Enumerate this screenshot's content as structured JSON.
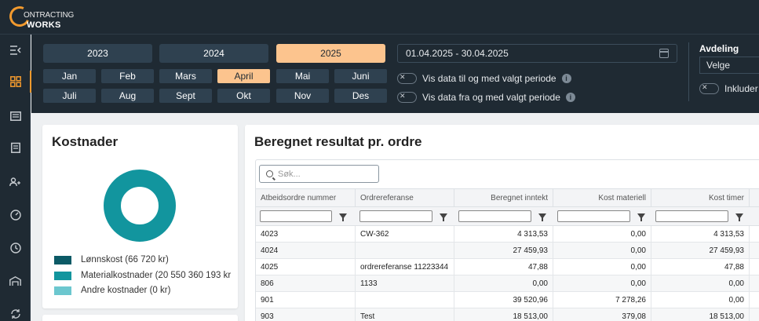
{
  "app": {
    "logo_line1": "ONTRACTING",
    "logo_line2": "WORKS"
  },
  "sidebar": {
    "icons": [
      "menu-collapse-icon",
      "dashboard-icon",
      "document-list-icon",
      "clipboard-icon",
      "users-icon",
      "gauge-icon",
      "clock-icon",
      "warehouse-icon",
      "sync-icon"
    ],
    "active": "dashboard-icon"
  },
  "filters": {
    "years": [
      "2023",
      "2024",
      "2025"
    ],
    "selected_year": "2025",
    "months_row1": [
      "Jan",
      "Feb",
      "Mars",
      "April",
      "Mai",
      "Juni"
    ],
    "months_row2": [
      "Juli",
      "Aug",
      "Sept",
      "Okt",
      "Nov",
      "Des"
    ],
    "selected_month": "April",
    "date_range": "01.04.2025 - 30.04.2025",
    "toggle1_label": "Vis data til og med valgt periode",
    "toggle2_label": "Vis data fra og med valgt periode",
    "avdeling_label": "Avdeling",
    "avdeling_value": "Velge",
    "include_label": "Inkluder"
  },
  "kostnader": {
    "title": "Kostnader",
    "legend": [
      {
        "label": "Lønnskost (66 720 kr)",
        "color": "#0c5a66"
      },
      {
        "label": "Materialkostnader (20 550 360 193 kr",
        "color": "#12959e"
      },
      {
        "label": "Andre kostnader (0 kr)",
        "color": "#6cc7cf"
      }
    ],
    "donut_color": "#12959e"
  },
  "resultat": {
    "title": "Beregnet resultat pr. ordre",
    "search_placeholder": "Søk...",
    "columns": [
      "Atbeidsordre nummer",
      "Ordrereferanse",
      "Beregnet inntekt",
      "Kost materiell",
      "Kost timer"
    ],
    "rows": [
      [
        "4023",
        "CW-362",
        "4 313,53",
        "0,00",
        "4 313,53"
      ],
      [
        "4024",
        "",
        "27 459,93",
        "0,00",
        "27 459,93"
      ],
      [
        "4025",
        "ordrereferanse 11223344",
        "47,88",
        "0,00",
        "47,88"
      ],
      [
        "806",
        "1133",
        "0,00",
        "0,00",
        "0,00"
      ],
      [
        "901",
        "",
        "39 520,96",
        "7 278,26",
        "0,00"
      ],
      [
        "903",
        "Test",
        "18 513,00",
        "379,08",
        "18 513,00"
      ]
    ]
  }
}
